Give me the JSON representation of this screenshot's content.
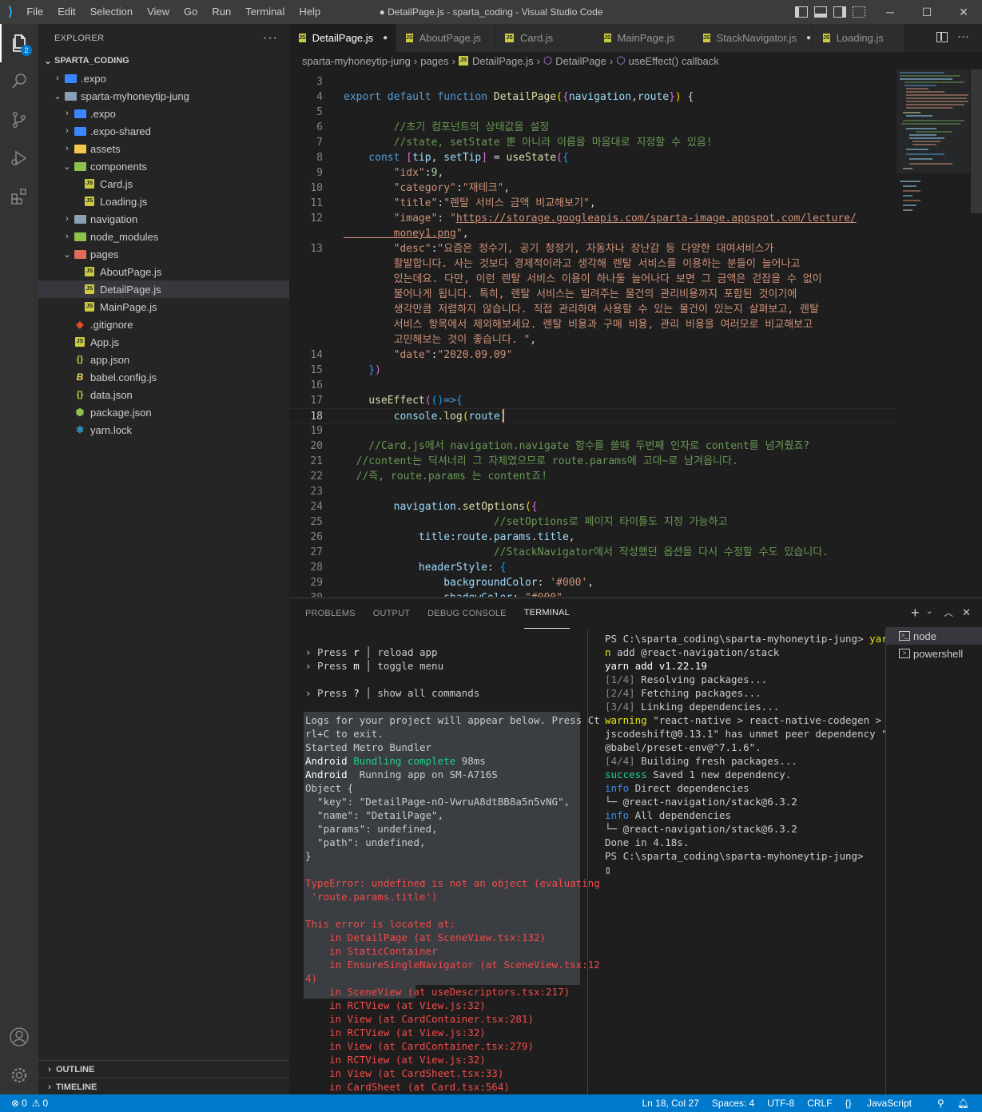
{
  "titlebar": {
    "menu": [
      "File",
      "Edit",
      "Selection",
      "View",
      "Go",
      "Run",
      "Terminal",
      "Help"
    ],
    "title": "● DetailPage.js - sparta_coding - Visual Studio Code"
  },
  "activity": {
    "explorer_badge": "2"
  },
  "explorer": {
    "header": "EXPLORER",
    "root": "SPARTA_CODING",
    "items": [
      {
        "label": ".expo",
        "depth": 1,
        "kind": "folder",
        "open": false,
        "color": "#3a86ff"
      },
      {
        "label": "sparta-myhoneytip-jung",
        "depth": 1,
        "kind": "folder",
        "open": true,
        "color": "#8aa0b6"
      },
      {
        "label": ".expo",
        "depth": 2,
        "kind": "folder",
        "open": false,
        "color": "#3a86ff"
      },
      {
        "label": ".expo-shared",
        "depth": 2,
        "kind": "folder",
        "open": false,
        "color": "#3a86ff"
      },
      {
        "label": "assets",
        "depth": 2,
        "kind": "folder",
        "open": false,
        "color": "#f4c84a"
      },
      {
        "label": "components",
        "depth": 2,
        "kind": "folder",
        "open": true,
        "color": "#8dc149"
      },
      {
        "label": "Card.js",
        "depth": 3,
        "kind": "js"
      },
      {
        "label": "Loading.js",
        "depth": 3,
        "kind": "js"
      },
      {
        "label": "navigation",
        "depth": 2,
        "kind": "folder",
        "open": false,
        "color": "#8aa0b6"
      },
      {
        "label": "node_modules",
        "depth": 2,
        "kind": "folder",
        "open": false,
        "color": "#8dc149"
      },
      {
        "label": "pages",
        "depth": 2,
        "kind": "folder",
        "open": true,
        "color": "#e06c5b"
      },
      {
        "label": "AboutPage.js",
        "depth": 3,
        "kind": "js"
      },
      {
        "label": "DetailPage.js",
        "depth": 3,
        "kind": "js",
        "selected": true
      },
      {
        "label": "MainPage.js",
        "depth": 3,
        "kind": "js"
      },
      {
        "label": ".gitignore",
        "depth": 2,
        "kind": "git"
      },
      {
        "label": "App.js",
        "depth": 2,
        "kind": "js"
      },
      {
        "label": "app.json",
        "depth": 2,
        "kind": "json"
      },
      {
        "label": "babel.config.js",
        "depth": 2,
        "kind": "babel"
      },
      {
        "label": "data.json",
        "depth": 2,
        "kind": "json"
      },
      {
        "label": "package.json",
        "depth": 2,
        "kind": "pkg"
      },
      {
        "label": "yarn.lock",
        "depth": 2,
        "kind": "yarn"
      }
    ],
    "outline": "OUTLINE",
    "timeline": "TIMELINE"
  },
  "tabs": [
    {
      "label": "DetailPage.js",
      "active": true,
      "dirty": true
    },
    {
      "label": "AboutPage.js"
    },
    {
      "label": "Card.js"
    },
    {
      "label": "MainPage.js"
    },
    {
      "label": "StackNavigator.js",
      "dirty": true
    },
    {
      "label": "Loading.js"
    }
  ],
  "breadcrumb": [
    "sparta-myhoneytip-jung",
    "pages",
    "DetailPage.js",
    "DetailPage",
    "useEffect() callback"
  ],
  "editor": {
    "lines": [
      {
        "n": "3",
        "t": []
      },
      {
        "n": "4",
        "t": [
          [
            "k",
            "export "
          ],
          [
            "k",
            "default "
          ],
          [
            "k",
            "function "
          ],
          [
            "f",
            "DetailPage"
          ],
          [
            "by",
            "("
          ],
          [
            "br",
            "{"
          ],
          [
            "v",
            "navigation"
          ],
          [
            "p",
            ","
          ],
          [
            "v",
            "route"
          ],
          [
            "br",
            "}"
          ],
          [
            "by",
            ")"
          ],
          [
            "p",
            " {"
          ]
        ]
      },
      {
        "n": "5",
        "t": []
      },
      {
        "n": "6",
        "t": [
          [
            "c",
            "        //초기 컴포넌트의 상태값을 설정"
          ]
        ]
      },
      {
        "n": "7",
        "t": [
          [
            "c",
            "        //state, setState 뿐 아니라 이름을 마음대로 지정할 수 있음!"
          ]
        ]
      },
      {
        "n": "8",
        "t": [
          [
            "k",
            "    const "
          ],
          [
            "br",
            "["
          ],
          [
            "v",
            "tip"
          ],
          [
            "p",
            ", "
          ],
          [
            "v",
            "setTip"
          ],
          [
            "br",
            "]"
          ],
          [
            "p",
            " = "
          ],
          [
            "f",
            "useState"
          ],
          [
            "br",
            "("
          ],
          [
            "bb",
            "{"
          ]
        ]
      },
      {
        "n": "9",
        "t": [
          [
            "s",
            "        \"idx\""
          ],
          [
            "p",
            ":"
          ],
          [
            "n",
            "9"
          ],
          [
            "p",
            ","
          ]
        ]
      },
      {
        "n": "10",
        "t": [
          [
            "s",
            "        \"category\""
          ],
          [
            "p",
            ":"
          ],
          [
            "s",
            "\"재테크\""
          ],
          [
            "p",
            ","
          ]
        ]
      },
      {
        "n": "11",
        "t": [
          [
            "s",
            "        \"title\""
          ],
          [
            "p",
            ":"
          ],
          [
            "s",
            "\"렌탈 서비스 금액 비교해보기\""
          ],
          [
            "p",
            ","
          ]
        ]
      },
      {
        "n": "12",
        "t": [
          [
            "s",
            "        \"image\""
          ],
          [
            "p",
            ": "
          ],
          [
            "s",
            "\""
          ],
          [
            "surl",
            "https://storage.googleapis.com/sparta-image.appspot.com/lecture/"
          ]
        ]
      },
      {
        "n": "",
        "t": [
          [
            "surl",
            "        money1.png"
          ],
          [
            "s",
            "\""
          ],
          [
            "p",
            ","
          ]
        ]
      },
      {
        "n": "13",
        "t": [
          [
            "s",
            "        \"desc\""
          ],
          [
            "p",
            ":"
          ],
          [
            "s",
            "\"요즘은 정수기, 공기 청정기, 자동차나 장난감 등 다양한 대여서비스가"
          ]
        ]
      },
      {
        "n": "",
        "t": [
          [
            "s",
            "        활발합니다. 사는 것보다 경제적이라고 생각해 렌탈 서비스를 이용하는 분들이 늘어나고"
          ]
        ]
      },
      {
        "n": "",
        "t": [
          [
            "s",
            "        있는데요. 다만, 이런 렌탈 서비스 이용이 하나둘 늘어나다 보면 그 금액은 걷잡을 수 없이"
          ]
        ]
      },
      {
        "n": "",
        "t": [
          [
            "s",
            "        불어나게 됩니다. 특히, 렌탈 서비스는 빌려주는 물건의 관리비용까지 포함된 것이기에"
          ]
        ]
      },
      {
        "n": "",
        "t": [
          [
            "s",
            "        생각만큼 저렴하지 않습니다. 직접 관리하며 사용할 수 있는 물건이 있는지 살펴보고, 렌탈"
          ]
        ]
      },
      {
        "n": "",
        "t": [
          [
            "s",
            "        서비스 항목에서 제외해보세요. 렌탈 비용과 구매 비용, 관리 비용을 여러모로 비교해보고"
          ]
        ]
      },
      {
        "n": "",
        "t": [
          [
            "s",
            "        고민해보는 것이 좋습니다. \""
          ],
          [
            "p",
            ","
          ]
        ]
      },
      {
        "n": "14",
        "t": [
          [
            "s",
            "        \"date\""
          ],
          [
            "p",
            ":"
          ],
          [
            "s",
            "\"2020.09.09\""
          ]
        ]
      },
      {
        "n": "15",
        "t": [
          [
            "bb",
            "    }"
          ],
          [
            "br",
            ")"
          ]
        ]
      },
      {
        "n": "16",
        "t": []
      },
      {
        "n": "17",
        "t": [
          [
            "f",
            "    useEffect"
          ],
          [
            "br",
            "("
          ],
          [
            "bb",
            "()"
          ],
          [
            "k",
            "=>"
          ],
          [
            "bb",
            "{"
          ]
        ]
      },
      {
        "n": "18",
        "t": [
          [
            "v",
            "        console"
          ],
          [
            "p",
            "."
          ],
          [
            "f",
            "log"
          ],
          [
            "by",
            "("
          ],
          [
            "v",
            "route"
          ],
          [
            "by",
            ")"
          ]
        ],
        "cur": true
      },
      {
        "n": "19",
        "t": []
      },
      {
        "n": "20",
        "t": [
          [
            "c",
            "    //Card.js에서 navigation.navigate 함수를 쓸때 두번째 인자로 content를 넘겨줬죠?"
          ]
        ]
      },
      {
        "n": "21",
        "t": [
          [
            "c",
            "  //content는 딕셔너리 그 자체였으므로 route.params에 고대~로 남겨옵니다."
          ]
        ]
      },
      {
        "n": "22",
        "t": [
          [
            "c",
            "  //즉, route.params 는 content죠!"
          ]
        ]
      },
      {
        "n": "23",
        "t": []
      },
      {
        "n": "24",
        "t": [
          [
            "v",
            "        navigation"
          ],
          [
            "p",
            "."
          ],
          [
            "f",
            "setOptions"
          ],
          [
            "by",
            "("
          ],
          [
            "br",
            "{"
          ]
        ]
      },
      {
        "n": "25",
        "t": [
          [
            "c",
            "                        //setOptions로 페이지 타이틀도 지정 가능하고"
          ]
        ]
      },
      {
        "n": "26",
        "t": [
          [
            "v",
            "            title"
          ],
          [
            "p",
            ":"
          ],
          [
            "v",
            "route"
          ],
          [
            "p",
            "."
          ],
          [
            "v",
            "params"
          ],
          [
            "p",
            "."
          ],
          [
            "v",
            "title"
          ],
          [
            "p",
            ","
          ]
        ]
      },
      {
        "n": "27",
        "t": [
          [
            "c",
            "                        //StackNavigator에서 작성했던 옵션을 다시 수정할 수도 있습니다."
          ]
        ]
      },
      {
        "n": "28",
        "t": [
          [
            "v",
            "            headerStyle"
          ],
          [
            "p",
            ": "
          ],
          [
            "bb",
            "{"
          ]
        ]
      },
      {
        "n": "29",
        "t": [
          [
            "v",
            "                backgroundColor"
          ],
          [
            "p",
            ": "
          ],
          [
            "s",
            "'#000'"
          ],
          [
            "p",
            ","
          ]
        ]
      },
      {
        "n": "30",
        "t": [
          [
            "v",
            "                shadowColor"
          ],
          [
            "p",
            ": "
          ],
          [
            "s",
            "\"#000\""
          ],
          [
            "p",
            ","
          ]
        ]
      }
    ]
  },
  "panel": {
    "tabs": [
      "PROBLEMS",
      "OUTPUT",
      "DEBUG CONSOLE",
      "TERMINAL"
    ],
    "active": "TERMINAL",
    "left_term": [
      [],
      [
        [
          "",
          "› Press "
        ],
        [
          "b",
          "r"
        ],
        [
          "",
          " │ reload app"
        ]
      ],
      [
        [
          "",
          "› Press "
        ],
        [
          "b",
          "m"
        ],
        [
          "",
          " │ toggle menu"
        ]
      ],
      [],
      [
        [
          "",
          "› Press "
        ],
        [
          "b",
          "?"
        ],
        [
          "",
          " │ show all commands"
        ]
      ],
      [],
      [
        [
          "",
          "Logs for your project will appear below. Press Ct"
        ]
      ],
      [
        [
          "",
          "rl+C to exit."
        ]
      ],
      [
        [
          "",
          "Started Metro Bundler"
        ]
      ],
      [
        [
          "b",
          "Android "
        ],
        [
          "g",
          "Bundling complete"
        ],
        [
          "",
          " 98ms"
        ]
      ],
      [
        [
          "b",
          "Android "
        ],
        [
          "",
          " Running app on SM-A716S"
        ]
      ],
      [
        [
          "",
          "Object {"
        ]
      ],
      [
        [
          "",
          "  \"key\": \"DetailPage-nO-VwruA8dtBB8a5n5vNG\","
        ]
      ],
      [
        [
          "",
          "  \"name\": \"DetailPage\","
        ]
      ],
      [
        [
          "",
          "  \"params\": undefined,"
        ]
      ],
      [
        [
          "",
          "  \"path\": undefined,"
        ]
      ],
      [
        [
          "",
          "}"
        ]
      ],
      [],
      [
        [
          "r",
          "TypeError: undefined is not an object (evaluating"
        ]
      ],
      [
        [
          "r",
          " 'route.params.title')"
        ]
      ],
      [],
      [
        [
          "r",
          "This error is located at:"
        ]
      ],
      [
        [
          "r",
          "    in DetailPage (at SceneView.tsx:132)"
        ]
      ],
      [
        [
          "r",
          "    in StaticContainer"
        ]
      ],
      [
        [
          "r",
          "    in EnsureSingleNavigator (at SceneView.tsx:12"
        ]
      ],
      [
        [
          "r",
          "4)"
        ]
      ],
      [
        [
          "r",
          "    in SceneView (at useDescriptors.tsx:217)"
        ]
      ],
      [
        [
          "r",
          "    in RCTView (at View.js:32)"
        ]
      ],
      [
        [
          "r",
          "    in View (at CardContainer.tsx:281)"
        ]
      ],
      [
        [
          "r",
          "    in RCTView (at View.js:32)"
        ]
      ],
      [
        [
          "r",
          "    in View (at CardContainer.tsx:279)"
        ]
      ],
      [
        [
          "r",
          "    in RCTView (at View.js:32)"
        ]
      ],
      [
        [
          "r",
          "    in View (at CardSheet.tsx:33)"
        ]
      ],
      [
        [
          "r",
          "    in CardSheet (at Card.tsx:564)"
        ]
      ]
    ],
    "right_term": [
      [
        [
          "",
          "PS C:\\sparta_coding\\sparta-myhoneytip-jung> "
        ],
        [
          "y",
          "yar"
        ]
      ],
      [
        [
          "y",
          "n"
        ],
        [
          "",
          " add @react-navigation/stack"
        ]
      ],
      [
        [
          "b",
          "yarn add v1.22.19"
        ]
      ],
      [
        [
          "gray",
          "[1/4]"
        ],
        [
          "",
          " Resolving packages..."
        ]
      ],
      [
        [
          "gray",
          "[2/4]"
        ],
        [
          "",
          " Fetching packages..."
        ]
      ],
      [
        [
          "gray",
          "[3/4]"
        ],
        [
          "",
          " Linking dependencies..."
        ]
      ],
      [
        [
          "y",
          "warning"
        ],
        [
          "",
          " \"react-native > react-native-codegen >"
        ]
      ],
      [
        [
          "",
          "jscodeshift@0.13.1\" has unmet peer dependency \""
        ]
      ],
      [
        [
          "",
          "@babel/preset-env@^7.1.6\"."
        ]
      ],
      [
        [
          "gray",
          "[4/4]"
        ],
        [
          "",
          " Building fresh packages..."
        ]
      ],
      [
        [
          "g",
          "success"
        ],
        [
          "",
          " Saved 1 new dependency."
        ]
      ],
      [
        [
          "bl",
          "info"
        ],
        [
          "",
          " Direct dependencies"
        ]
      ],
      [
        [
          "",
          "└─ @react-navigation/stack@6.3.2"
        ]
      ],
      [
        [
          "bl",
          "info"
        ],
        [
          "",
          " All dependencies"
        ]
      ],
      [
        [
          "",
          "└─ @react-navigation/stack@6.3.2"
        ]
      ],
      [
        [
          "",
          "Done in 4.18s."
        ]
      ],
      [
        [
          "",
          "PS C:\\sparta_coding\\sparta-myhoneytip-jung>"
        ]
      ],
      [
        [
          "cursor",
          "▯"
        ]
      ]
    ],
    "terminals": [
      "node",
      "powershell"
    ]
  },
  "statusbar": {
    "errors": "0",
    "warnings": "0",
    "position": "Ln 18, Col 27",
    "spaces": "Spaces: 4",
    "encoding": "UTF-8",
    "eol": "CRLF",
    "language": "JavaScript"
  }
}
